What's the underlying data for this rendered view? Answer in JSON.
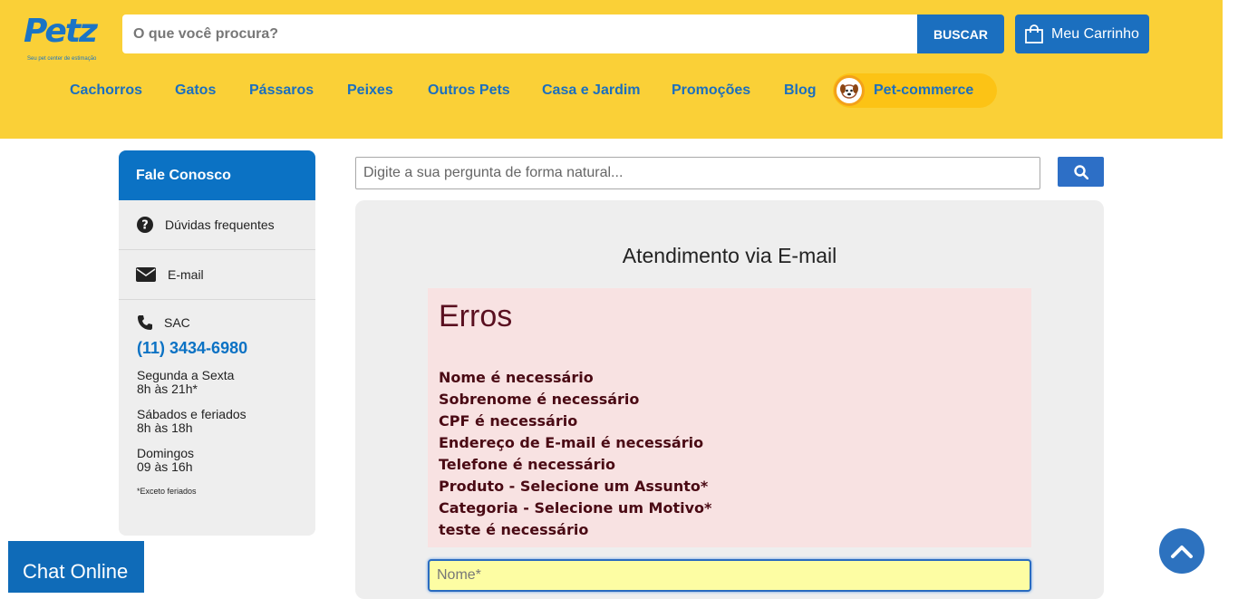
{
  "header": {
    "logo_text": "Petz",
    "logo_tagline": "Seu pet center de estimação",
    "search_placeholder": "O que você procura?",
    "search_button": "BUSCAR",
    "cart_label": "Meu Carrinho",
    "nav": [
      "Cachorros",
      "Gatos",
      "Pássaros",
      "Peixes",
      "Outros Pets",
      "Casa e Jardim",
      "Promoções",
      "Blog"
    ],
    "petcommerce_label": "Pet-commerce",
    "colors": {
      "background": "#fad037",
      "primary": "#1b6fbf"
    }
  },
  "sidebar": {
    "title": "Fale Conosco",
    "items": [
      {
        "label": "Dúvidas frequentes",
        "icon": "question-circle-icon"
      },
      {
        "label": "E-mail",
        "icon": "envelope-icon"
      }
    ],
    "sac": {
      "label": "SAC",
      "icon": "phone-icon",
      "phone": "(11) 3434-6980",
      "hours": [
        {
          "days": "Segunda a Sexta",
          "time": "8h às 21h*"
        },
        {
          "days": "Sábados e feriados",
          "time": "8h às 18h"
        },
        {
          "days": "Domingos",
          "time": "09 às 16h"
        }
      ],
      "note": "*Exceto feriados"
    }
  },
  "main": {
    "question_placeholder": "Digite a sua pergunta de forma natural...",
    "search_icon": "magnifier-icon",
    "title": "Atendimento via E-mail",
    "errors": {
      "title": "Erros",
      "items": [
        "Nome é necessário",
        "Sobrenome é necessário",
        "CPF é necessário",
        "Endereço de E-mail é necessário",
        "Telefone é necessário",
        "Produto - Selecione um Assunto*",
        "Categoria - Selecione um Motivo*",
        "teste é necessário"
      ]
    },
    "nome_placeholder": "Nome*"
  },
  "chat_label": "Chat Online",
  "back_to_top_icon": "chevron-up-icon"
}
